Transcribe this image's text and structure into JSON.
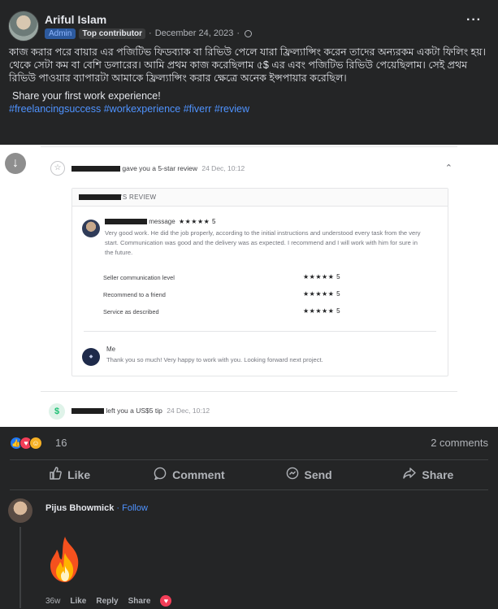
{
  "post": {
    "author": "Ariful Islam",
    "badge_admin": "Admin",
    "badge_top": "Top contributor",
    "date": "December 24, 2023",
    "separator": "·",
    "more": "···",
    "text_bn": "কাজ করার পরে বায়ার এর পজিটিভ ফিডব্যাক বা রিভিউ পেলে যারা ফ্রিল্যান্সিং করেন তাদের অন্যরকম একটা ফিলিং হয়। থেকে সেটা কম বা বেশি ডলারের। আমি প্রথম কাজ করেছিলাম ৫$ এর এবং পজিটিভ রিভিউ পেয়েছিলাম। সেই প্রথম রিভিউ পাওয়ার ব্যাপারটা আমাকে ফ্রিল্যান্সিং করার ক্ষেত্রে অনেক ইন্সপায়ার করেছিল।",
    "text_en": "Share your first work experience!",
    "hashtags": "#freelancingsuccess #workexperience #fiverr #review"
  },
  "screenshot": {
    "review_header": "gave you a 5-star review",
    "review_date": "24 Dec, 10:12",
    "box_title": "'S REVIEW",
    "buyer_message_label": "message",
    "buyer_stars": "★★★★★ 5",
    "review_text": "Very good work. He did the job properly, according to the initial instructions and understood every task from the very start. Communication was good and the delivery was as expected. I recommend and I will work with him for sure in the future.",
    "ratings": [
      {
        "label": "Seller communication level",
        "stars": "★★★★★ 5"
      },
      {
        "label": "Recommend to a friend",
        "stars": "★★★★★ 5"
      },
      {
        "label": "Service as described",
        "stars": "★★★★★ 5"
      }
    ],
    "me_name": "Me",
    "me_text": "Thank you so much! Very happy to work with you. Looking forward next project.",
    "tip_text": "left you a US$5 tip",
    "tip_date": "24 Dec, 10:12"
  },
  "reactions": {
    "count": "16",
    "comments": "2 comments"
  },
  "actions": {
    "like": "Like",
    "comment": "Comment",
    "send": "Send",
    "share": "Share"
  },
  "comment": {
    "author": "Pijus Bhowmick",
    "follow": "Follow",
    "time": "36w",
    "like": "Like",
    "reply": "Reply",
    "share": "Share"
  }
}
